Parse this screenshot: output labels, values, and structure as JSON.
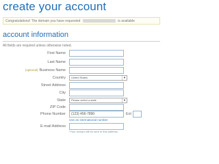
{
  "page": {
    "title": "create your account"
  },
  "notice": {
    "prefix": "Congratulations! The domain you have requested",
    "suffix": "is available"
  },
  "section": {
    "title": "account information",
    "required_note": "All fields are required unless otherwise noted."
  },
  "form": {
    "first_name": {
      "label": "First Name",
      "value": ""
    },
    "last_name": {
      "label": "Last Name",
      "value": ""
    },
    "business_name": {
      "label": "Business Name",
      "optional_tag": "(optional)",
      "value": ""
    },
    "country": {
      "label": "Country",
      "value": "United States"
    },
    "street_address": {
      "label": "Street Address",
      "value": ""
    },
    "city": {
      "label": "City",
      "value": ""
    },
    "state": {
      "label": "State",
      "value": "Please select a state"
    },
    "zip": {
      "label": "ZIP Code",
      "value": ""
    },
    "phone": {
      "label": "Phone Number",
      "value": "(123) 456-7890",
      "ext_label": "Ext",
      "intl_link": "Use an international number"
    },
    "email": {
      "label": "E-mail Address",
      "value": "",
      "hint": "*Your receipt will be sent to this address."
    }
  },
  "icons": {
    "select_arrow": "chevron-down-icon"
  }
}
